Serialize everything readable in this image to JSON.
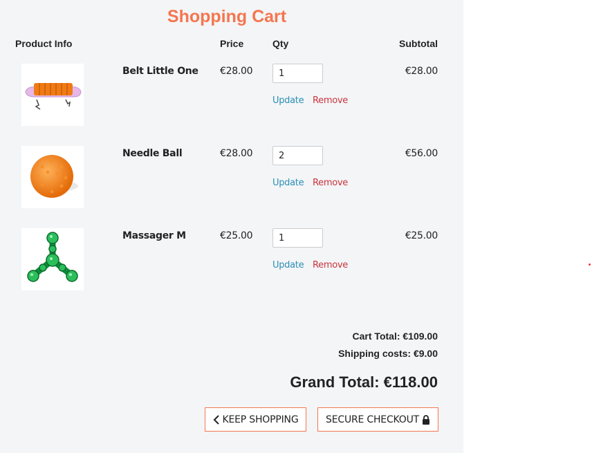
{
  "page": {
    "title": "Shopping Cart"
  },
  "columns": {
    "product": "Product Info",
    "price": "Price",
    "qty": "Qty",
    "subtotal": "Subtotal"
  },
  "items": [
    {
      "name": "Belt Little One",
      "price": "€28.00",
      "qty": "1",
      "subtotal": "€28.00",
      "update": "Update",
      "remove": "Remove",
      "image": "belt-image"
    },
    {
      "name": "Needle Ball",
      "price": "€28.00",
      "qty": "2",
      "subtotal": "€56.00",
      "update": "Update",
      "remove": "Remove",
      "image": "needle-ball-image"
    },
    {
      "name": "Massager M",
      "price": "€25.00",
      "qty": "1",
      "subtotal": "€25.00",
      "update": "Update",
      "remove": "Remove",
      "image": "massager-image"
    }
  ],
  "totals": {
    "cart_total": "Cart Total: €109.00",
    "shipping": "Shipping costs: €9.00",
    "grand_total": "Grand Total: €118.00"
  },
  "buttons": {
    "keep_shopping": "KEEP SHOPPING",
    "secure_checkout": "SECURE CHECKOUT"
  },
  "colors": {
    "accent": "#f5764e",
    "update": "#2a8fb5",
    "remove": "#c8343c",
    "panel": "#f4f5f7"
  },
  "icons": {
    "keep_shopping": "chevron-left-icon",
    "secure_checkout": "lock-icon"
  }
}
